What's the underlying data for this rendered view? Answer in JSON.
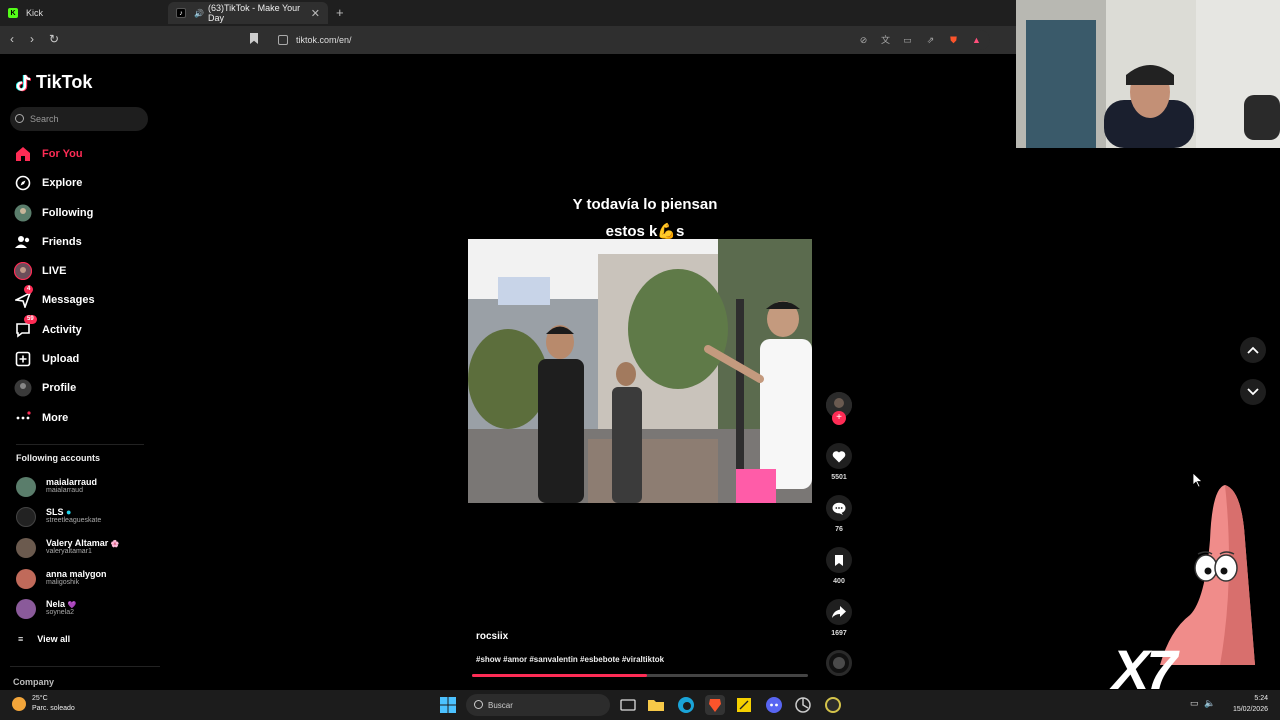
{
  "browser": {
    "tabs": [
      {
        "title": "Kick",
        "color": "#53fc18"
      },
      {
        "title": "(63)TikTok - Make Your Day",
        "active": true
      }
    ],
    "url": "tiktok.com/en/"
  },
  "sidebar": {
    "logo": "TikTok",
    "search_placeholder": "Search",
    "nav": [
      {
        "label": "For You",
        "icon": "home-icon",
        "active": true
      },
      {
        "label": "Explore",
        "icon": "compass-icon"
      },
      {
        "label": "Following",
        "icon": "following-avatar-icon"
      },
      {
        "label": "Friends",
        "icon": "friends-icon"
      },
      {
        "label": "LIVE",
        "icon": "live-icon"
      },
      {
        "label": "Messages",
        "icon": "messages-icon",
        "badge": "4"
      },
      {
        "label": "Activity",
        "icon": "activity-icon",
        "badge": "59"
      },
      {
        "label": "Upload",
        "icon": "upload-icon"
      },
      {
        "label": "Profile",
        "icon": "profile-icon"
      },
      {
        "label": "More",
        "icon": "more-icon"
      }
    ],
    "following_title": "Following accounts",
    "accounts": [
      {
        "name": "maialarraud",
        "handle": "maialarraud",
        "color": "#5a7d6b"
      },
      {
        "name": "SLS",
        "handle": "streetleagueskate",
        "color": "#222"
      },
      {
        "name": "Valery Altamar",
        "handle": "valeryaltamar1",
        "color": "#6b5a4e"
      },
      {
        "name": "anna malygon",
        "handle": "maligoshik",
        "color": "#c06a5a"
      },
      {
        "name": "Nela",
        "handle": "soynela2",
        "color": "#8a5a9a"
      }
    ],
    "view_all": "View all",
    "company": "Company"
  },
  "video": {
    "caption_line1": "Y todavía lo piensan",
    "caption_line2": "estos k💪s",
    "author": "rocsiix",
    "hashtags": "#show #amor #sanvalentin #esbebote #viraltiktok",
    "progress": 0.52,
    "actions": {
      "likes": "5501",
      "comments": "76",
      "saves": "400",
      "shares": "1697"
    }
  },
  "overlay": {
    "sticker_text": "X7"
  },
  "taskbar": {
    "weather_temp": "25°C",
    "weather_desc": "Parc. soleado",
    "search_placeholder": "Buscar",
    "time": "5:24",
    "date": "15/02/2026"
  }
}
